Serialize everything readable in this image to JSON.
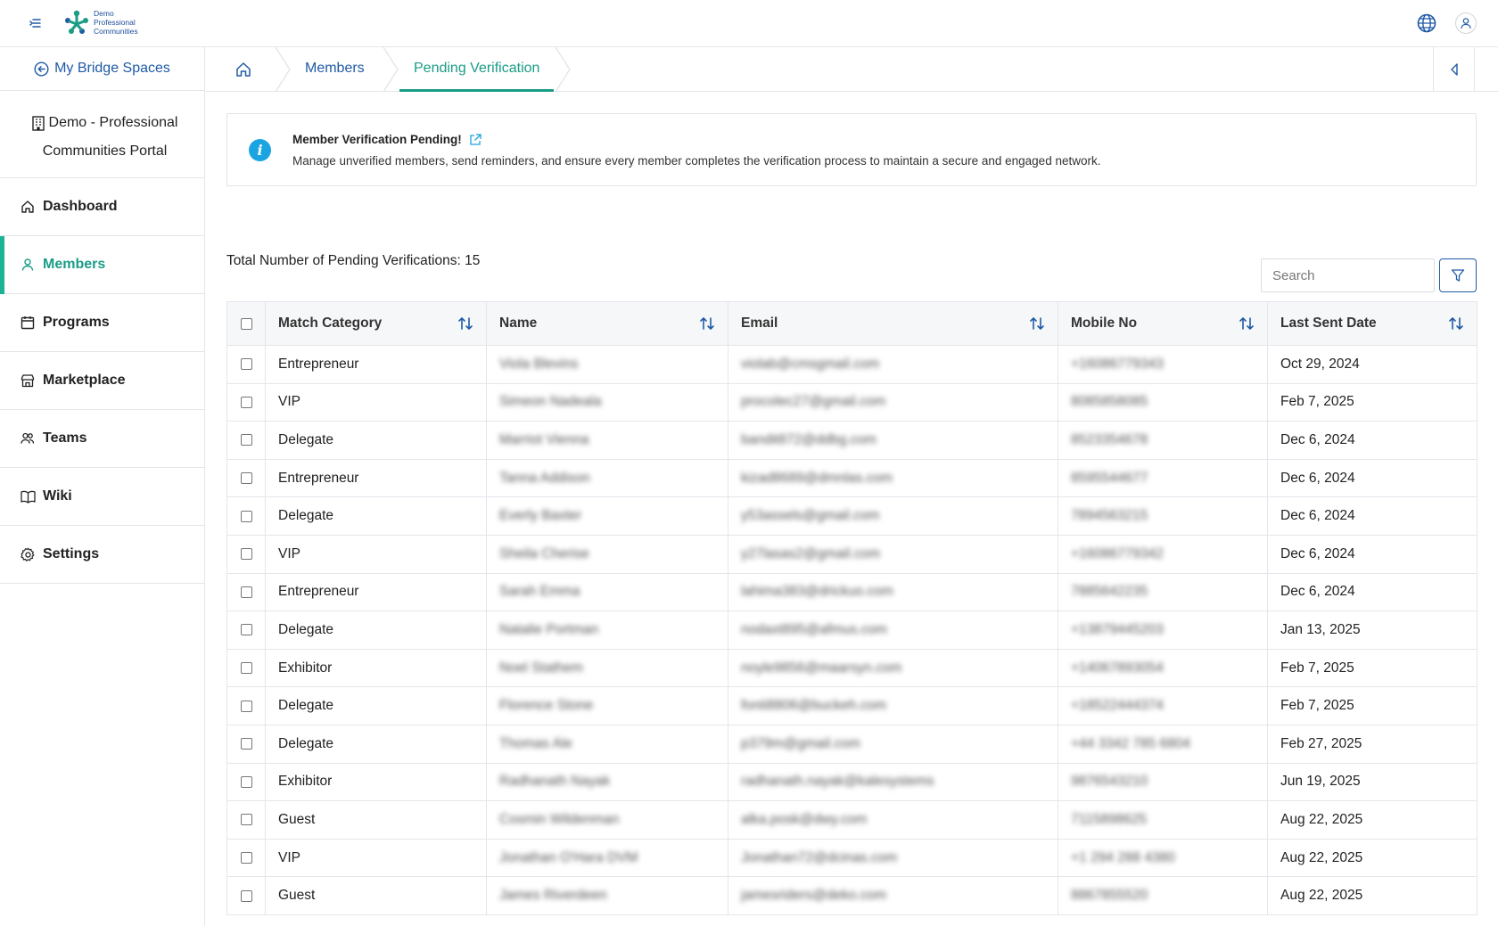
{
  "header": {
    "logo_lines": [
      "Demo",
      "Professional",
      "Communities"
    ]
  },
  "sidebar": {
    "back_label": "My Bridge Spaces",
    "org_line1": "Demo - Professional",
    "org_line2": "Communities Portal",
    "items": [
      {
        "label": "Dashboard",
        "icon": "home-icon"
      },
      {
        "label": "Members",
        "icon": "user-icon",
        "active": true
      },
      {
        "label": "Programs",
        "icon": "calendar-icon"
      },
      {
        "label": "Marketplace",
        "icon": "store-icon"
      },
      {
        "label": "Teams",
        "icon": "users-icon"
      },
      {
        "label": "Wiki",
        "icon": "book-icon"
      },
      {
        "label": "Settings",
        "icon": "gear-icon"
      }
    ]
  },
  "breadcrumb": {
    "items": [
      "Members",
      "Pending Verification"
    ]
  },
  "info": {
    "title": "Member Verification Pending!",
    "description": "Manage unverified members, send reminders, and ensure every member completes the verification process to maintain a secure and engaged network."
  },
  "toolbar": {
    "total_label": "Total Number of Pending Verifications: 15",
    "search_placeholder": "Search"
  },
  "table": {
    "columns": [
      "Match Category",
      "Name",
      "Email",
      "Mobile No",
      "Last Sent Date"
    ],
    "rows": [
      {
        "category": "Entrepreneur",
        "name": "Viola Blevins",
        "email": "violab@cmsgmail.com",
        "mobile": "+16086779343",
        "date": "Oct 29, 2024"
      },
      {
        "category": "VIP",
        "name": "Simeon Nadeala",
        "email": "procolec27@gmail.com",
        "mobile": "8085858085",
        "date": "Feb 7, 2025"
      },
      {
        "category": "Delegate",
        "name": "Marriot Vienna",
        "email": "bandit872@ddbg.com",
        "mobile": "8523354678",
        "date": "Dec 6, 2024"
      },
      {
        "category": "Entrepreneur",
        "name": "Tanna Addison",
        "email": "kizad8689@dmnlas.com",
        "mobile": "8595544677",
        "date": "Dec 6, 2024"
      },
      {
        "category": "Delegate",
        "name": "Everly Baxter",
        "email": "y53assels@gmail.com",
        "mobile": "7894563215",
        "date": "Dec 6, 2024"
      },
      {
        "category": "VIP",
        "name": "Sheila Cherise",
        "email": "y27lasas2@gmail.com",
        "mobile": "+16086779342",
        "date": "Dec 6, 2024"
      },
      {
        "category": "Entrepreneur",
        "name": "Sarah Emma",
        "email": "lahima383@drickuo.com",
        "mobile": "7885642235",
        "date": "Dec 6, 2024"
      },
      {
        "category": "Delegate",
        "name": "Natalie Portman",
        "email": "nodaxt895@afmus.com",
        "mobile": "+13879445203",
        "date": "Jan 13, 2025"
      },
      {
        "category": "Exhibitor",
        "name": "Noel Stathem",
        "email": "noyle9856@maarsyn.com",
        "mobile": "+14067893054",
        "date": "Feb 7, 2025"
      },
      {
        "category": "Delegate",
        "name": "Florence Stone",
        "email": "fonti8806@buckeh.com",
        "mobile": "+18522444374",
        "date": "Feb 7, 2025"
      },
      {
        "category": "Delegate",
        "name": "Thomas Ale",
        "email": "p379m@gmail.com",
        "mobile": "+44 3342 785 6804",
        "date": "Feb 27, 2025"
      },
      {
        "category": "Exhibitor",
        "name": "Radhanath Nayak",
        "email": "radhanath.nayak@kalesystems",
        "mobile": "9876543210",
        "date": "Jun 19, 2025"
      },
      {
        "category": "Guest",
        "name": "Cosmin Wildenman",
        "email": "alka.posk@dwy.com",
        "mobile": "7115898625",
        "date": "Aug 22, 2025"
      },
      {
        "category": "VIP",
        "name": "Jonathan O'Hara DVM",
        "email": "Jonathan72@dcinas.com",
        "mobile": "+1 294 288 4380",
        "date": "Aug 22, 2025"
      },
      {
        "category": "Guest",
        "name": "James Riverdeen",
        "email": "jamesriders@deko.com",
        "mobile": "8867855520",
        "date": "Aug 22, 2025"
      }
    ]
  },
  "colors": {
    "accent": "#1a9c86",
    "link": "#1f5aa6",
    "info": "#1ba4e2"
  }
}
